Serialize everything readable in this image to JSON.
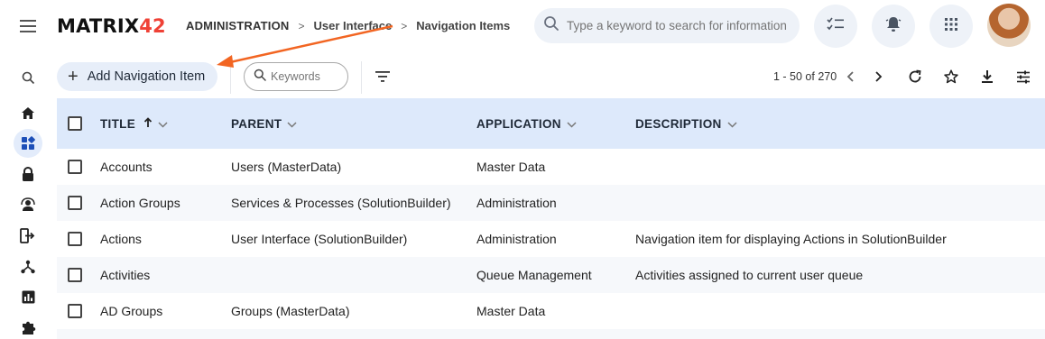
{
  "app": {
    "logo_main": "MATRIX",
    "logo_accent": "42"
  },
  "breadcrumb": {
    "items": [
      "ADMINISTRATION",
      "User Interface",
      "Navigation Items"
    ]
  },
  "header": {
    "search_placeholder": "Type a keyword to search for information",
    "icons": [
      "tasks-icon",
      "notifications-icon",
      "apps-grid-icon"
    ]
  },
  "toolbar": {
    "add_label": "Add Navigation Item",
    "keywords_placeholder": "Keywords",
    "pager_text": "1 - 50 of 270"
  },
  "table": {
    "columns": [
      "TITLE",
      "PARENT",
      "APPLICATION",
      "DESCRIPTION"
    ],
    "sort_column": "TITLE",
    "sort_direction": "ascending",
    "rows": [
      {
        "title": "Accounts",
        "parent": "Users (MasterData)",
        "application": "Master Data",
        "description": ""
      },
      {
        "title": "Action Groups",
        "parent": "Services & Processes (SolutionBuilder)",
        "application": "Administration",
        "description": ""
      },
      {
        "title": "Actions",
        "parent": "User Interface (SolutionBuilder)",
        "application": "Administration",
        "description": "Navigation item for displaying Actions in SolutionBuilder"
      },
      {
        "title": "Activities",
        "parent": "",
        "application": "Queue Management",
        "description": "Activities assigned to current user queue"
      },
      {
        "title": "AD Groups",
        "parent": "Groups (MasterData)",
        "application": "Master Data",
        "description": ""
      }
    ]
  },
  "colors": {
    "accent": "#ef4136",
    "header_row": "#dde9fb",
    "active_nav": "#e3ecfb",
    "annotation_arrow": "#f26522"
  }
}
